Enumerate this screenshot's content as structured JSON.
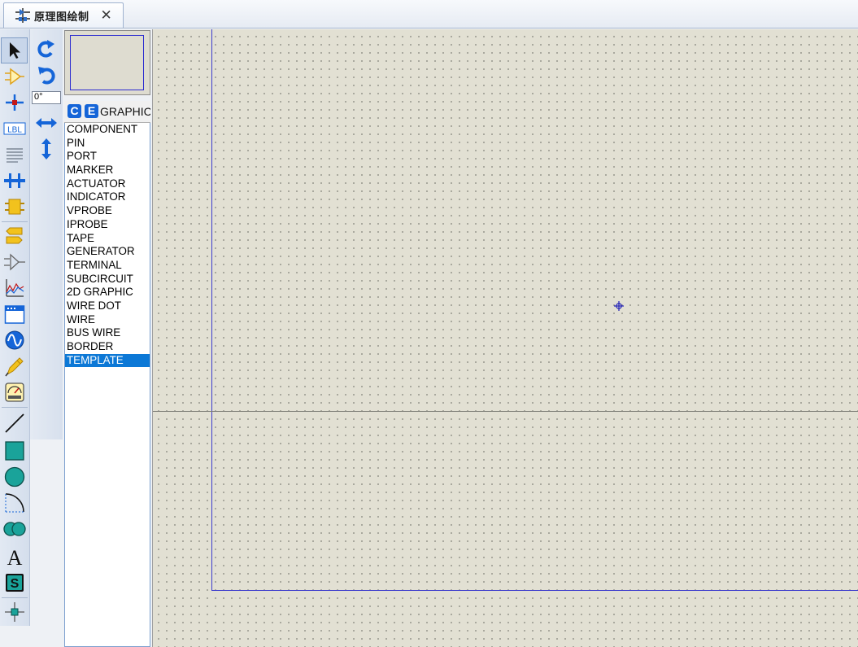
{
  "tab": {
    "title": "原理图绘制",
    "icon": "schematic-icon",
    "close_label": "✕"
  },
  "tools": [
    {
      "name": "selection-mode",
      "icon": "arrow-pointer-icon",
      "selected": true
    },
    {
      "name": "component-mode",
      "icon": "component-icon"
    },
    {
      "name": "junction-dot-mode",
      "icon": "junction-dot-icon"
    },
    {
      "name": "wire-label-mode",
      "icon": "wire-label-icon",
      "text": "LBL"
    },
    {
      "name": "text-script-mode",
      "icon": "text-script-icon"
    },
    {
      "name": "buses-mode",
      "icon": "bus-icon"
    },
    {
      "name": "subcircuit-mode",
      "icon": "subcircuit-icon"
    },
    {
      "name": "terminals-mode",
      "icon": "terminal-icon"
    },
    {
      "name": "device-pins-mode",
      "icon": "device-pin-icon"
    },
    {
      "name": "graph-mode",
      "icon": "graph-icon"
    },
    {
      "name": "tape-recorder-mode",
      "icon": "tape-recorder-icon"
    },
    {
      "name": "generator-mode",
      "icon": "generator-icon"
    },
    {
      "name": "voltage-probe-mode",
      "icon": "probe-icon"
    },
    {
      "name": "virtual-instrument-mode",
      "icon": "instrument-icon"
    },
    {
      "name": "2d-line-mode",
      "icon": "line-icon"
    },
    {
      "name": "2d-box-mode",
      "icon": "box-icon"
    },
    {
      "name": "2d-circle-mode",
      "icon": "circle-icon"
    },
    {
      "name": "2d-arc-mode",
      "icon": "arc-icon"
    },
    {
      "name": "2d-path-mode",
      "icon": "path-icon"
    },
    {
      "name": "2d-text-mode",
      "icon": "text-icon",
      "text": "A"
    },
    {
      "name": "2d-symbol-mode",
      "icon": "symbol-icon",
      "text": "S"
    },
    {
      "name": "2d-marker-mode",
      "icon": "marker-icon"
    }
  ],
  "orientation": {
    "rotate_cw": "rotate-clockwise-icon",
    "rotate_ccw": "rotate-anticlockwise-icon",
    "angle": "0°",
    "mirror_x": "mirror-horizontal-icon",
    "mirror_y": "mirror-vertical-icon"
  },
  "selector": {
    "btn_c": "C",
    "btn_e": "E",
    "title": "GRAPHIC"
  },
  "list": {
    "items": [
      "COMPONENT",
      "PIN",
      "PORT",
      "MARKER",
      "ACTUATOR",
      "INDICATOR",
      "VPROBE",
      "IPROBE",
      "TAPE",
      "GENERATOR",
      "TERMINAL",
      "SUBCIRCUIT",
      "2D GRAPHIC",
      "WIRE DOT",
      "WIRE",
      "BUS WIRE",
      "BORDER",
      "TEMPLATE"
    ],
    "selected": "TEMPLATE"
  },
  "colors": {
    "canvas": "#e2e0d3",
    "sheet_border": "#3c3ccd",
    "selection": "#0c78d6",
    "tool_blue": "#1565d8"
  }
}
